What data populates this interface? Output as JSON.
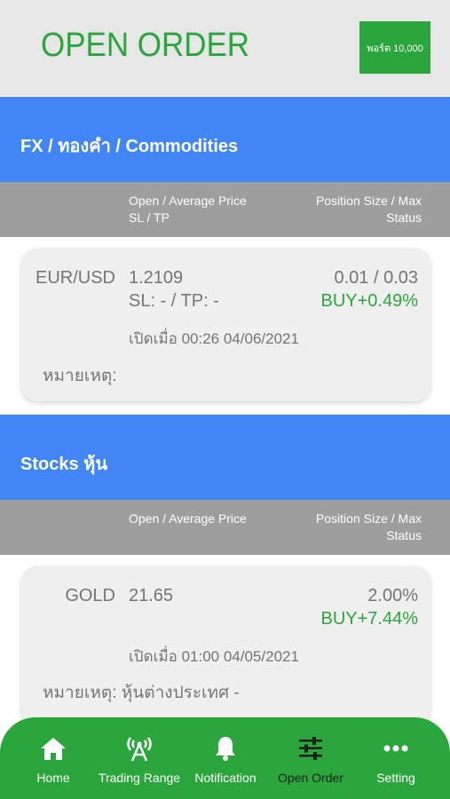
{
  "header": {
    "title": "OPEN ORDER",
    "port_button": "พอร์ต 10,000"
  },
  "fx_section": {
    "title": "FX / ทองคำ / Commodities",
    "col_left_1": "Open / Average Price",
    "col_left_2": "SL / TP",
    "col_right_1": "Position Size / Max",
    "col_right_2": "Status",
    "order": {
      "symbol": "EUR/USD",
      "price": "1.2109",
      "sltp": "SL: - / TP: -",
      "size": "0.01 / 0.03",
      "status": "BUY+0.49%",
      "opened": "เปิดเมื่อ 00:26 04/06/2021",
      "note": "หมายเหตุ:"
    }
  },
  "stocks_section": {
    "title": "Stocks หุ้น",
    "col_left_1": "Open / Average Price",
    "col_right_1": "Position Size / Max",
    "col_right_2": "Status",
    "order": {
      "symbol": "GOLD",
      "price": "21.65",
      "size": "2.00%",
      "status": "BUY+7.44%",
      "opened": "เปิดเมื่อ 01:00 04/05/2021",
      "note": "หมายเหตุ: หุ้นต่างประเทศ -"
    }
  },
  "nav": {
    "home": "Home",
    "trading_range": "Trading Range",
    "notification": "Notification",
    "open_order": "Open Order",
    "setting": "Setting",
    "active": "open_order"
  },
  "colors": {
    "accent_green": "#2aa63c",
    "section_blue": "#4285f4",
    "header_gray": "#9e9e9e"
  }
}
